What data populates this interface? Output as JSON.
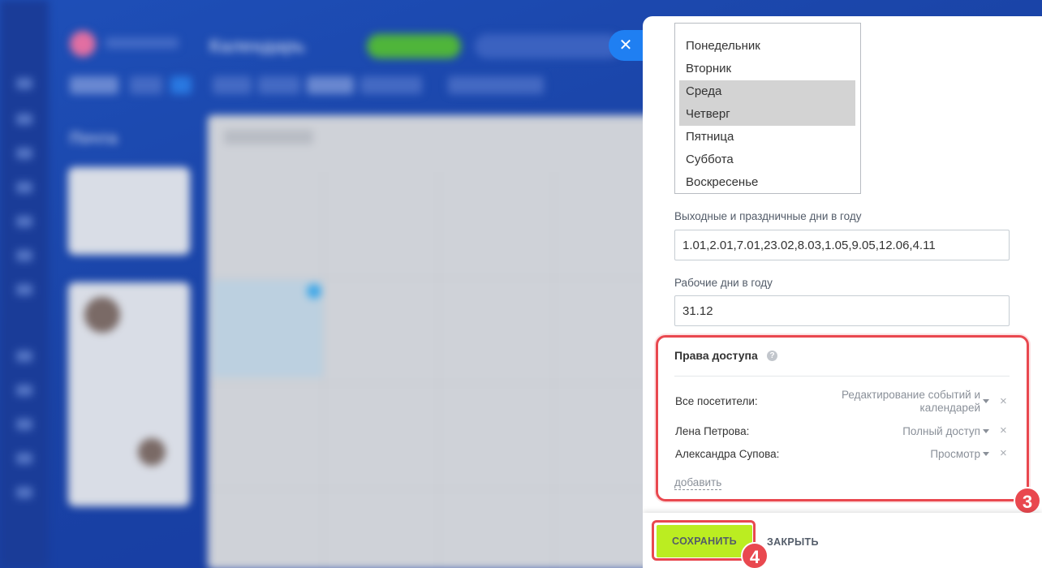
{
  "background": {
    "calendar_title": "Календарь",
    "left_title": "Почта"
  },
  "close_panel": {
    "icon": "close-icon",
    "glyph": "✕"
  },
  "weekdays": {
    "items": [
      {
        "label": "Понедельник",
        "selected": false
      },
      {
        "label": "Вторник",
        "selected": false
      },
      {
        "label": "Среда",
        "selected": true
      },
      {
        "label": "Четверг",
        "selected": true
      },
      {
        "label": "Пятница",
        "selected": false
      },
      {
        "label": "Суббота",
        "selected": false
      },
      {
        "label": "Воскресенье",
        "selected": false
      }
    ]
  },
  "holidays": {
    "label": "Выходные и праздничные дни в году",
    "value": "1.01,2.01,7.01,23.02,8.03,1.05,9.05,12.06,4.11"
  },
  "workdays": {
    "label": "Рабочие дни в году",
    "value": "31.12"
  },
  "access": {
    "title": "Права доступа",
    "help_glyph": "?",
    "rows": [
      {
        "name": "Все посетители:",
        "value_line1": "Редактирование событий и",
        "value_line2": "календарей"
      },
      {
        "name": "Лена Петрова:",
        "value_line1": "Полный доступ",
        "value_line2": ""
      },
      {
        "name": "Александра Супова:",
        "value_line1": "Просмотр",
        "value_line2": ""
      }
    ],
    "remove_glyph": "×",
    "add_label": "добавить"
  },
  "annotations": {
    "badge_access": "3",
    "badge_save": "4",
    "highlight_color": "#e9484f"
  },
  "footer": {
    "save_label": "СОХРАНИТЬ",
    "close_label": "ЗАКРЫТЬ"
  },
  "colors": {
    "accent_blue": "#1f7ff2",
    "save_green": "#bbed21",
    "selected_row": "#d3d3d3"
  }
}
